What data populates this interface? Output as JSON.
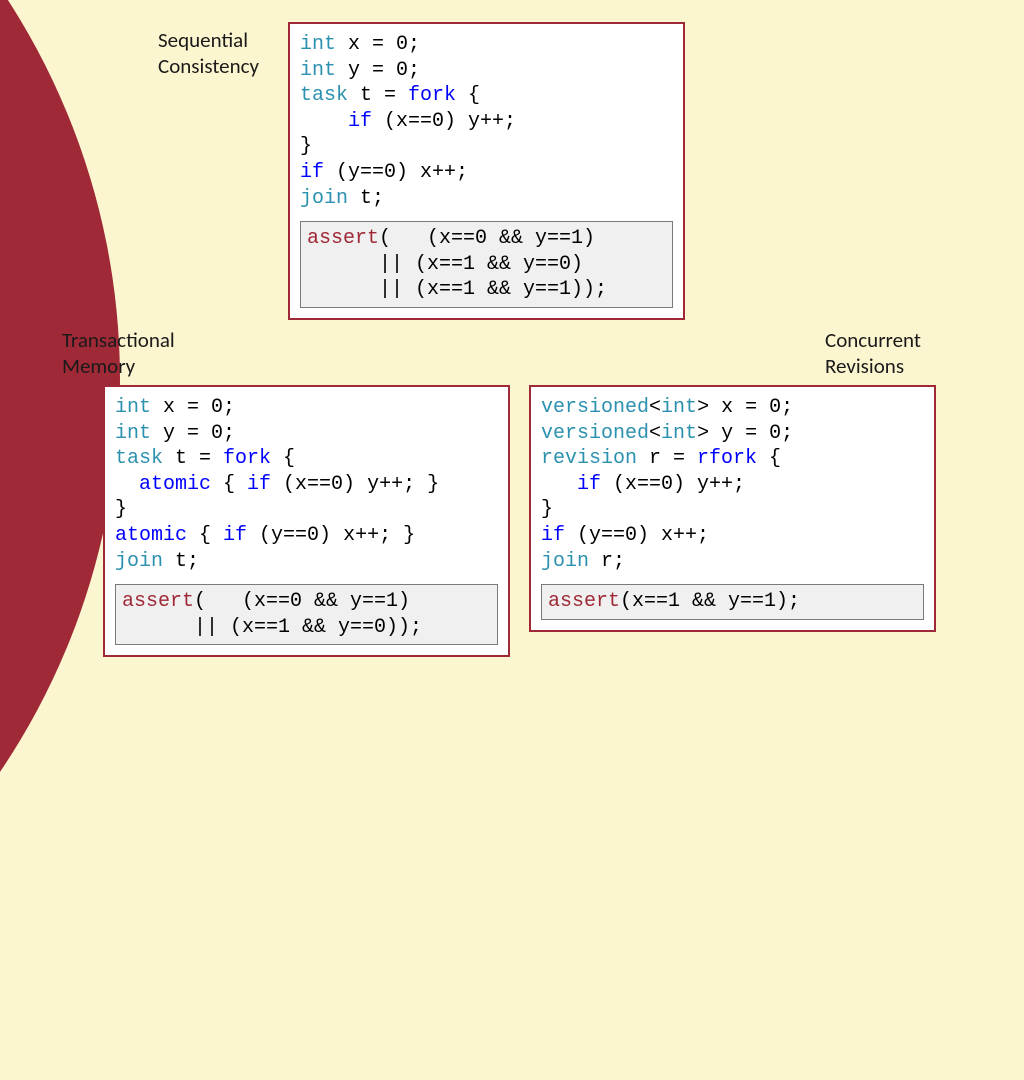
{
  "labels": {
    "sc_line1": "Sequential",
    "sc_line2": "Consistency",
    "tm_line1": "Transactional",
    "tm_line2": "Memory",
    "cr_line1": "Concurrent",
    "cr_line2": "Revisions"
  },
  "sc": {
    "l1a": "int",
    "l1b": " x = 0;",
    "l2a": "int",
    "l2b": " y = 0;",
    "l3a": "task",
    "l3b": " t = ",
    "l3c": "fork",
    "l3d": " {",
    "l4a": "    if",
    "l4b": " (x==0) y++;",
    "l5": "}",
    "l6a": "if",
    "l6b": " (y==0) x++;",
    "l7a": "join",
    "l7b": " t;",
    "a1a": "assert",
    "a1b": "(   (x==0 && y==1)",
    "a2": "      || (x==1 && y==0)",
    "a3": "      || (x==1 && y==1));"
  },
  "tm": {
    "l1a": "int",
    "l1b": " x = 0;",
    "l2a": "int",
    "l2b": " y = 0;",
    "l3a": "task",
    "l3b": " t = ",
    "l3c": "fork",
    "l3d": " {",
    "l4a": "  atomic",
    "l4b": " { ",
    "l4c": "if",
    "l4d": " (x==0) y++; }",
    "l5": "}",
    "l6a": "atomic",
    "l6b": " { ",
    "l6c": "if",
    "l6d": " (y==0) x++; }",
    "l7a": "join",
    "l7b": " t;",
    "a1a": "assert",
    "a1b": "(   (x==0 && y==1)",
    "a2": "      || (x==1 && y==0));"
  },
  "cr": {
    "l1a": "versioned",
    "l1b": "<",
    "l1c": "int",
    "l1d": "> x = 0;",
    "l2a": "versioned",
    "l2b": "<",
    "l2c": "int",
    "l2d": "> y = 0;",
    "l3a": "revision",
    "l3b": " r = ",
    "l3c": "rfork",
    "l3d": " {",
    "l4a": "   if",
    "l4b": " (x==0) y++;",
    "l5": "}",
    "l6a": "if",
    "l6b": " (y==0) x++;",
    "l7a": "join",
    "l7b": " r;",
    "a1a": "assert",
    "a1b": "(x==1 && y==1);"
  }
}
